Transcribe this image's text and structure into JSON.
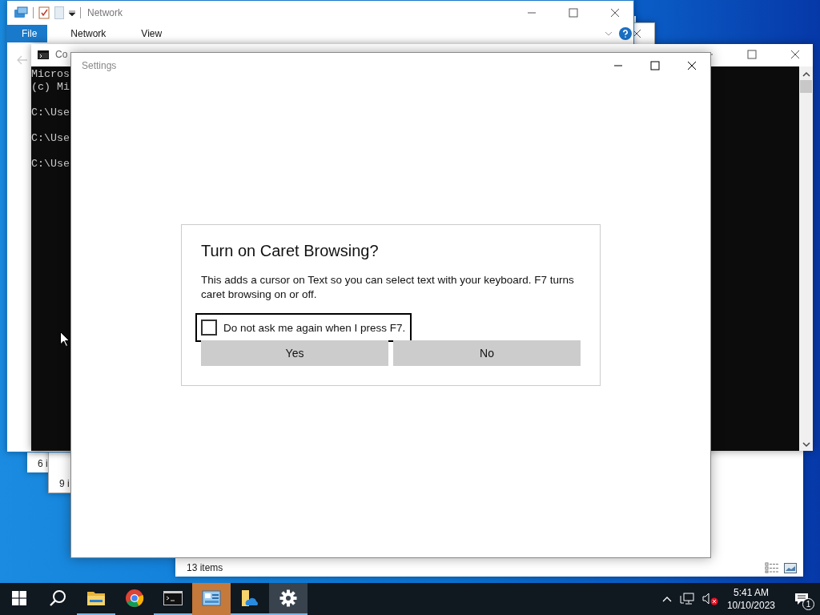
{
  "back_windows": [
    {
      "status": "6 i"
    },
    {
      "status": "9 i"
    }
  ],
  "explorer_window": {
    "status": "13 items"
  },
  "network_window": {
    "title": "Network",
    "ribbon_tabs": [
      {
        "label": "File",
        "selected": true
      },
      {
        "label": "Network",
        "selected": false
      },
      {
        "label": "View",
        "selected": false
      }
    ]
  },
  "console_window": {
    "title": "Co",
    "lines": [
      "Micros",
      "(c) Mi",
      "C:\\Use",
      "C:\\Use",
      "C:\\Use"
    ]
  },
  "settings_window": {
    "title": "Settings"
  },
  "dialog": {
    "title": "Turn on Caret Browsing?",
    "message": "This adds a cursor on Text so you can select text with your keyboard. F7 turns caret browsing on or off.",
    "checkbox": {
      "label": "Do not ask me again when I press F7.",
      "checked": false
    },
    "buttons": [
      "Yes",
      "No"
    ]
  },
  "taskbar": {
    "buttons": [
      {
        "kind": "start",
        "running": false,
        "active": false,
        "flashing": false
      },
      {
        "kind": "search",
        "running": false,
        "active": false,
        "flashing": false
      },
      {
        "kind": "folder",
        "running": true,
        "active": false,
        "flashing": false
      },
      {
        "kind": "browser",
        "running": false,
        "active": false,
        "flashing": false
      },
      {
        "kind": "terminal",
        "running": true,
        "active": false,
        "flashing": false
      },
      {
        "kind": "control-panel",
        "running": false,
        "active": false,
        "flashing": true
      },
      {
        "kind": "cloud-folder",
        "running": true,
        "active": false,
        "flashing": false
      },
      {
        "kind": "settings",
        "running": true,
        "active": true,
        "flashing": false
      }
    ],
    "time": "5:41 AM",
    "date": "10/10/2023",
    "notifications": "1"
  }
}
